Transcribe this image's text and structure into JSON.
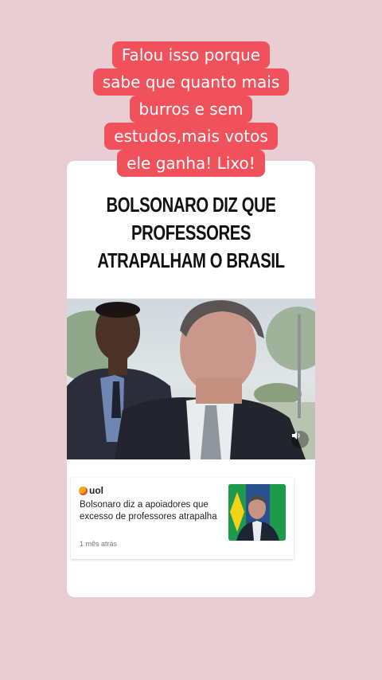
{
  "caption": {
    "lines": [
      "Falou isso porque",
      "sabe que quanto mais",
      "burros e sem",
      "estudos,mais votos",
      "ele ganha! Lixo!"
    ]
  },
  "headline": {
    "lines": [
      "BOLSONARO DIZ QUE",
      "PROFESSORES",
      "ATRAPALHAM O BRASIL"
    ]
  },
  "news": {
    "source": "uol",
    "title": "Bolsonaro diz a apoiadores que excesso de professores atrapalha",
    "time": "1 mês atrás"
  },
  "icons": {
    "sound": "speaker-icon",
    "source_logo": "uol-logo"
  },
  "colors": {
    "background": "#e8cdd2",
    "caption_bg": "#f0515b",
    "card_bg": "#ffffff"
  }
}
